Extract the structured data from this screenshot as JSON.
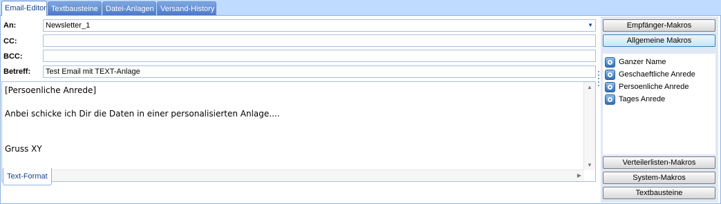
{
  "tabs": [
    "Email-Editor",
    "Textbausteine",
    "Datei-Anlagen",
    "Versand-History"
  ],
  "form": {
    "to_label": "An:",
    "to_value": "Newsletter_1",
    "cc_label": "CC:",
    "cc_value": "",
    "bcc_label": "BCC:",
    "bcc_value": "",
    "subject_label": "Betreff:",
    "subject_value": "Test Email mit TEXT-Anlage"
  },
  "editor": {
    "lines": [
      "[Persoenliche Anrede]",
      "",
      "Anbei schicke ich Dir die Daten in einer personalisierten Anlage....",
      "",
      "",
      "Gruss XY"
    ],
    "format_tab": "Text-Format"
  },
  "macros": {
    "top_buttons": [
      "Empfänger-Makros",
      "Allgemeine Makros"
    ],
    "items": [
      "Ganzer Name",
      "Geschaeftliche Anrede",
      "Persoenliche Anrede",
      "Tages Anrede"
    ],
    "bottom_buttons": [
      "Verteilerlisten-Makros",
      "System-Makros",
      "Textbausteine"
    ]
  }
}
